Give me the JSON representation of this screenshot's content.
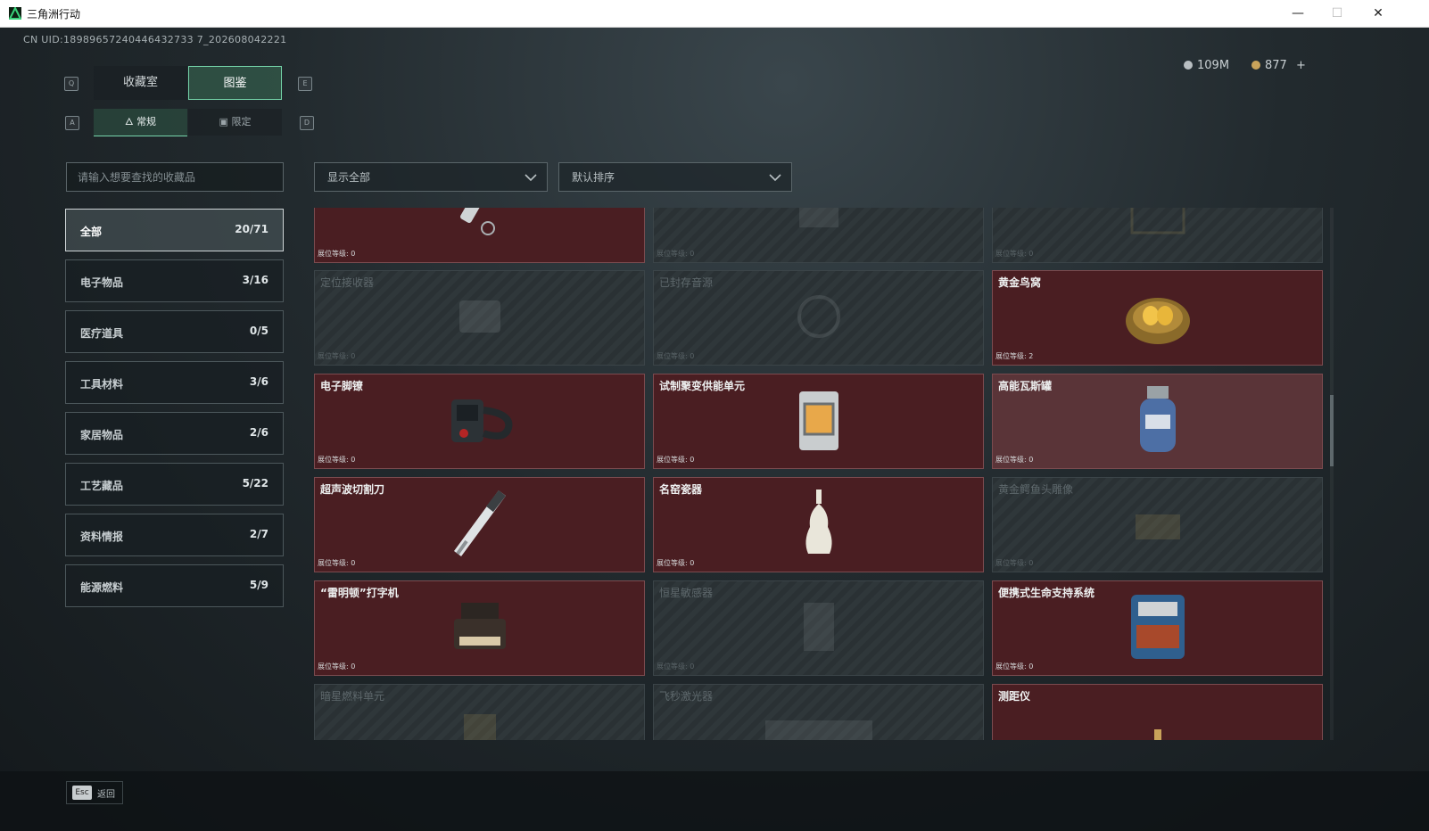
{
  "window": {
    "title": "三角洲行动",
    "minimize": "—",
    "maximize": "☐",
    "close": "✕"
  },
  "uid": "CN UID:18989657240446432733 7_202608042221",
  "currency": {
    "silver": "109M",
    "gold": "877",
    "add": "+"
  },
  "keys": {
    "q": "Q",
    "e": "E",
    "a": "A",
    "d": "D"
  },
  "tabs": {
    "collection": "收藏室",
    "codex": "图鉴"
  },
  "subtabs": {
    "regular": "常规",
    "limited": "限定"
  },
  "search": {
    "placeholder": "请输入想要查找的收藏品"
  },
  "filters": {
    "show": "显示全部",
    "sort": "默认排序"
  },
  "categories": [
    {
      "label": "全部",
      "count": "20/71"
    },
    {
      "label": "电子物品",
      "count": "3/16"
    },
    {
      "label": "医疗道具",
      "count": "0/5"
    },
    {
      "label": "工具材料",
      "count": "3/6"
    },
    {
      "label": "家居物品",
      "count": "2/6"
    },
    {
      "label": "工艺藏品",
      "count": "5/22"
    },
    {
      "label": "资料情报",
      "count": "2/7"
    },
    {
      "label": "能源燃料",
      "count": "5/9"
    }
  ],
  "items": [
    {
      "name": "",
      "level": "展位等级: 0",
      "state": "owned",
      "icon": "flashlight-icon"
    },
    {
      "name": "",
      "level": "展位等级: 0",
      "state": "locked",
      "icon": "device-icon"
    },
    {
      "name": "",
      "level": "展位等级: 0",
      "state": "locked",
      "icon": "frame-icon"
    },
    {
      "name": "定位接收器",
      "level": "展位等级: 0",
      "state": "locked",
      "icon": "receiver-icon"
    },
    {
      "name": "已封存音源",
      "level": "展位等级: 0",
      "state": "locked",
      "icon": "sound-source-icon"
    },
    {
      "name": "黄金鸟窝",
      "level": "展位等级: 2",
      "state": "owned",
      "icon": "golden-nest-icon"
    },
    {
      "name": "电子脚镣",
      "level": "展位等级: 0",
      "state": "owned",
      "icon": "ankle-monitor-icon"
    },
    {
      "name": "试制聚变供能单元",
      "level": "展位等级: 0",
      "state": "owned",
      "icon": "fusion-cell-icon"
    },
    {
      "name": "高能瓦斯罐",
      "level": "展位等级: 0",
      "state": "owned-light",
      "icon": "gas-canister-icon"
    },
    {
      "name": "超声波切割刀",
      "level": "展位等级: 0",
      "state": "owned",
      "icon": "ultrasonic-cutter-icon"
    },
    {
      "name": "名窑瓷器",
      "level": "展位等级: 0",
      "state": "owned",
      "icon": "porcelain-vase-icon"
    },
    {
      "name": "黄金鳄鱼头雕像",
      "level": "展位等级: 0",
      "state": "locked",
      "icon": "crocodile-statue-icon"
    },
    {
      "name": "“雷明顿”打字机",
      "level": "展位等级: 0",
      "state": "owned",
      "icon": "typewriter-icon"
    },
    {
      "name": "恒星敏感器",
      "level": "展位等级: 0",
      "state": "locked",
      "icon": "star-sensor-icon"
    },
    {
      "name": "便携式生命支持系统",
      "level": "展位等级: 0",
      "state": "owned",
      "icon": "life-support-icon"
    },
    {
      "name": "暗星燃料单元",
      "level": "",
      "state": "locked",
      "icon": "fuel-cell-icon"
    },
    {
      "name": "飞秒激光器",
      "level": "",
      "state": "locked",
      "icon": "laser-icon"
    },
    {
      "name": "测距仪",
      "level": "",
      "state": "owned",
      "icon": "rangefinder-icon"
    }
  ],
  "footer": {
    "esc_key": "Esc",
    "esc_label": "返回"
  },
  "colors": {
    "owned": "#4a1e22",
    "accent": "#74d3a8",
    "locked": "#2a3134"
  }
}
